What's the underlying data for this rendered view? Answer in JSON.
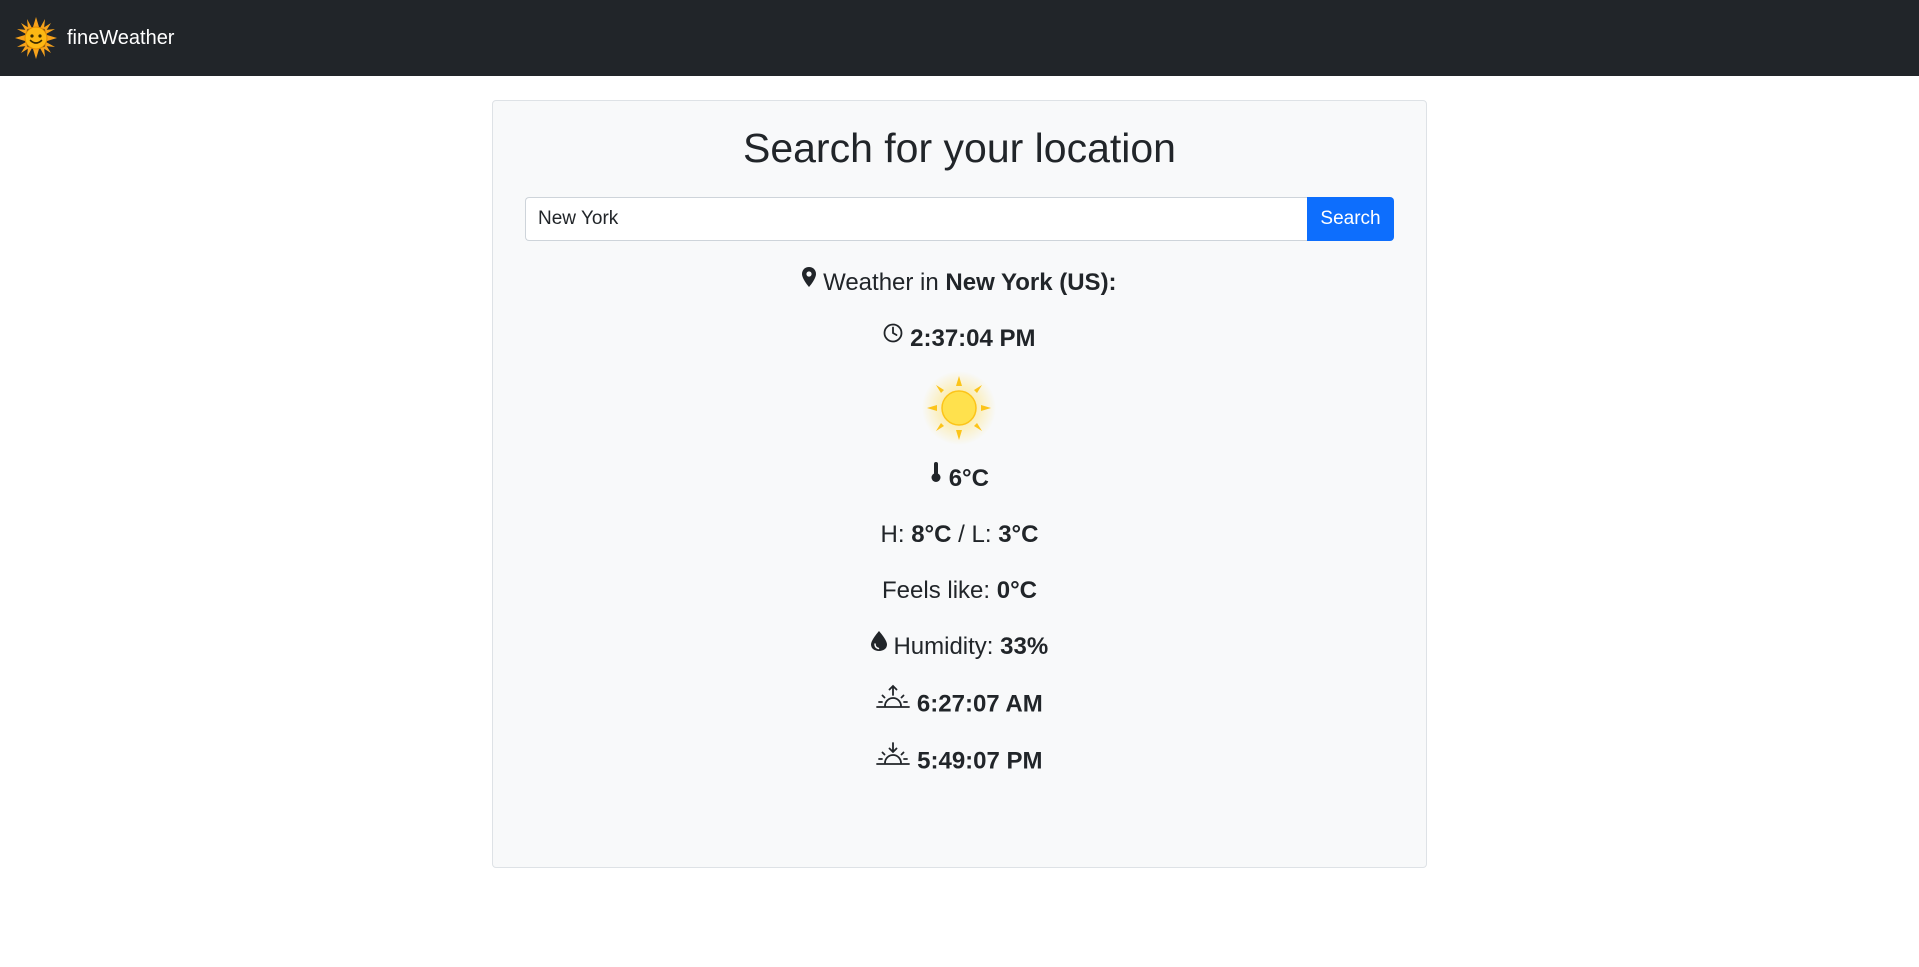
{
  "app": {
    "brand": "fineWeather",
    "logo_icon": "sun-face-icon"
  },
  "search": {
    "title": "Search for your location",
    "input_value": "New York",
    "button_label": "Search"
  },
  "weather": {
    "location_prefix": "Weather in",
    "location": "New York (US):",
    "time": "2:37:04 PM",
    "condition_icon": "sunny-icon",
    "temperature": "6°C",
    "high_prefix": "H:",
    "high": "8°C",
    "separator": "/ L:",
    "low": "3°C",
    "feels_like_prefix": "Feels like:",
    "feels_like": "0°C",
    "humidity_prefix": "Humidity:",
    "humidity": "33%",
    "sunrise": "6:27:07 AM",
    "sunset": "5:49:07 PM"
  },
  "colors": {
    "navbar": "#212529",
    "primary": "#0d6efd",
    "card_bg": "#f8f9fa",
    "sun": "#ffd43b"
  }
}
